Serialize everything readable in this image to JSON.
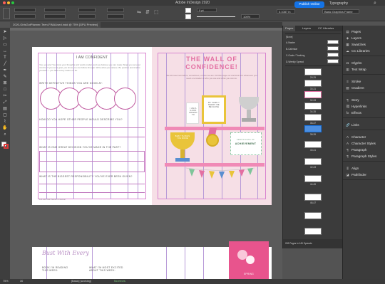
{
  "app": {
    "title": "Adobe InDesign 2020"
  },
  "control_bar": {
    "publish_label": "Publish Online",
    "workspace_label": "Typography",
    "coord_value": "0.1087 in",
    "swatch_label": "Basic Graphics Frame",
    "stroke_weight": "0 pt",
    "font_size": "100%"
  },
  "document": {
    "tab_label": "2020-GirlsGotPlanner-Teen-FINALised.indd @ 75% [GPU Preview]"
  },
  "left_page": {
    "heading": "I AM CONFIDENT",
    "intro": "Yes, you are! You know your thoughts and words matter, and you believe you can make things you set your mind to. If you set a goal, you know you can follow through. Write what you believe. Be positive and kind to yourself — you have every reason to be.",
    "q1": "WRITE DEFINITIVE THINGS YOU ARE GOOD AT:",
    "q2": "HOW DO YOU HOPE OTHER PEOPLE WOULD DESCRIBE YOU?",
    "q3": "WHAT IS ONE GREAT DECISION YOU'VE MADE IN THE PAST?",
    "q4": "WHAT IS THE BIGGEST RESPONSIBILITY YOU'VE EVER BEEN GIVEN?",
    "footer": "126   Girls Got Planner & Journal"
  },
  "right_page": {
    "title": "THE WALL OF CONFIDENCE!",
    "intro": "We all need reminders, sometimes, of who we are. Fill this page out and look at it whenever you need a reminder of who you are and what you can do.",
    "frame1": "I AM A GOOD FRIEND TO",
    "frame2": "MY FAMILY NEEDS ME BECAUSE",
    "trophy": "BEST THINGS I'VE DONE",
    "cert_top": "CERTIFICATE OF",
    "cert_main": "ACHIEVEMENT"
  },
  "lower_spread": {
    "script_title": "Bust With Every",
    "book_label": "BOOK I'M READING THIS WEEK:",
    "excited_label": "WHAT I'M MOST EXCITED ABOUT THIS WEEK:",
    "card_label": "SPRING"
  },
  "pages_panel": {
    "tabs": [
      "Pages",
      "Layers",
      "CC Libraries"
    ],
    "none_label": "[None]",
    "masters": [
      "A-Master",
      "B-Calendar",
      "C-Goals / Tracking",
      "D-Weekly Spread"
    ],
    "page_labels": [
      "28-29",
      "30-31",
      "32-33",
      "34-35",
      "36-37",
      "38-39",
      "40-41",
      "42-43",
      "44-45",
      "46-47"
    ],
    "footer": "263 Pages in 145 Spreads"
  },
  "side_panel": {
    "groups": [
      [
        "Pages",
        "Layers",
        "Swatches",
        "CC Libraries"
      ],
      [
        "Glyphs",
        "Text Wrap"
      ],
      [
        "Stroke",
        "Gradient"
      ],
      [
        "Story",
        "Hyperlinks",
        "Effects"
      ],
      [
        "Links"
      ],
      [
        "Character",
        "Character Styles",
        "Paragraph",
        "Paragraph Styles"
      ],
      [
        "Align",
        "Pathfinder"
      ]
    ]
  },
  "status": {
    "zoom": "75%",
    "page": "30",
    "style": "[Basic] (working)",
    "errors": "No errors"
  },
  "colors": {
    "accent": "#1473e6",
    "pink": "#e36fa2",
    "page_bg": "#f6dfe6",
    "gold": "#e9c43a"
  }
}
